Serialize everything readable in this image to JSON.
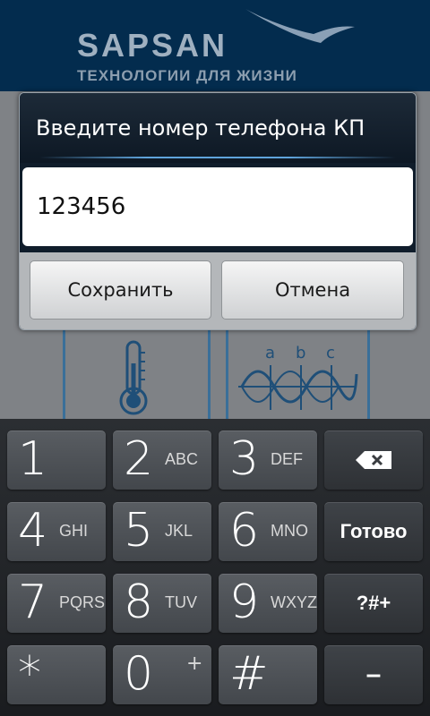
{
  "brand": {
    "name": "SAPSAN",
    "tagline": "ТЕХНОЛОГИИ ДЛЯ ЖИЗНИ"
  },
  "dialog": {
    "title": "Введите номер телефона КП",
    "input_value": "123456",
    "save_label": "Сохранить",
    "cancel_label": "Отмена"
  },
  "keyboard": {
    "rows": [
      [
        {
          "digit": "1",
          "letters": ""
        },
        {
          "digit": "2",
          "letters": "ABC"
        },
        {
          "digit": "3",
          "letters": "DEF"
        }
      ],
      [
        {
          "digit": "4",
          "letters": "GHI"
        },
        {
          "digit": "5",
          "letters": "JKL"
        },
        {
          "digit": "6",
          "letters": "MNO"
        }
      ],
      [
        {
          "digit": "7",
          "letters": "PQRS"
        },
        {
          "digit": "8",
          "letters": "TUV"
        },
        {
          "digit": "9",
          "letters": "WXYZ"
        }
      ]
    ],
    "bottom": {
      "star": "*",
      "zero": "0",
      "zero_sup": "+",
      "hash": "#"
    },
    "done_label": "Готово",
    "symbols_label": "?#+",
    "dash_label": "–"
  },
  "colors": {
    "header_bg": "#032c4e",
    "accent": "#5fa4dc",
    "key_bg": "#4d5156"
  },
  "icons": [
    "sapsan-bird-icon",
    "thermometer-icon",
    "wave-abc-icon",
    "backspace-icon"
  ]
}
